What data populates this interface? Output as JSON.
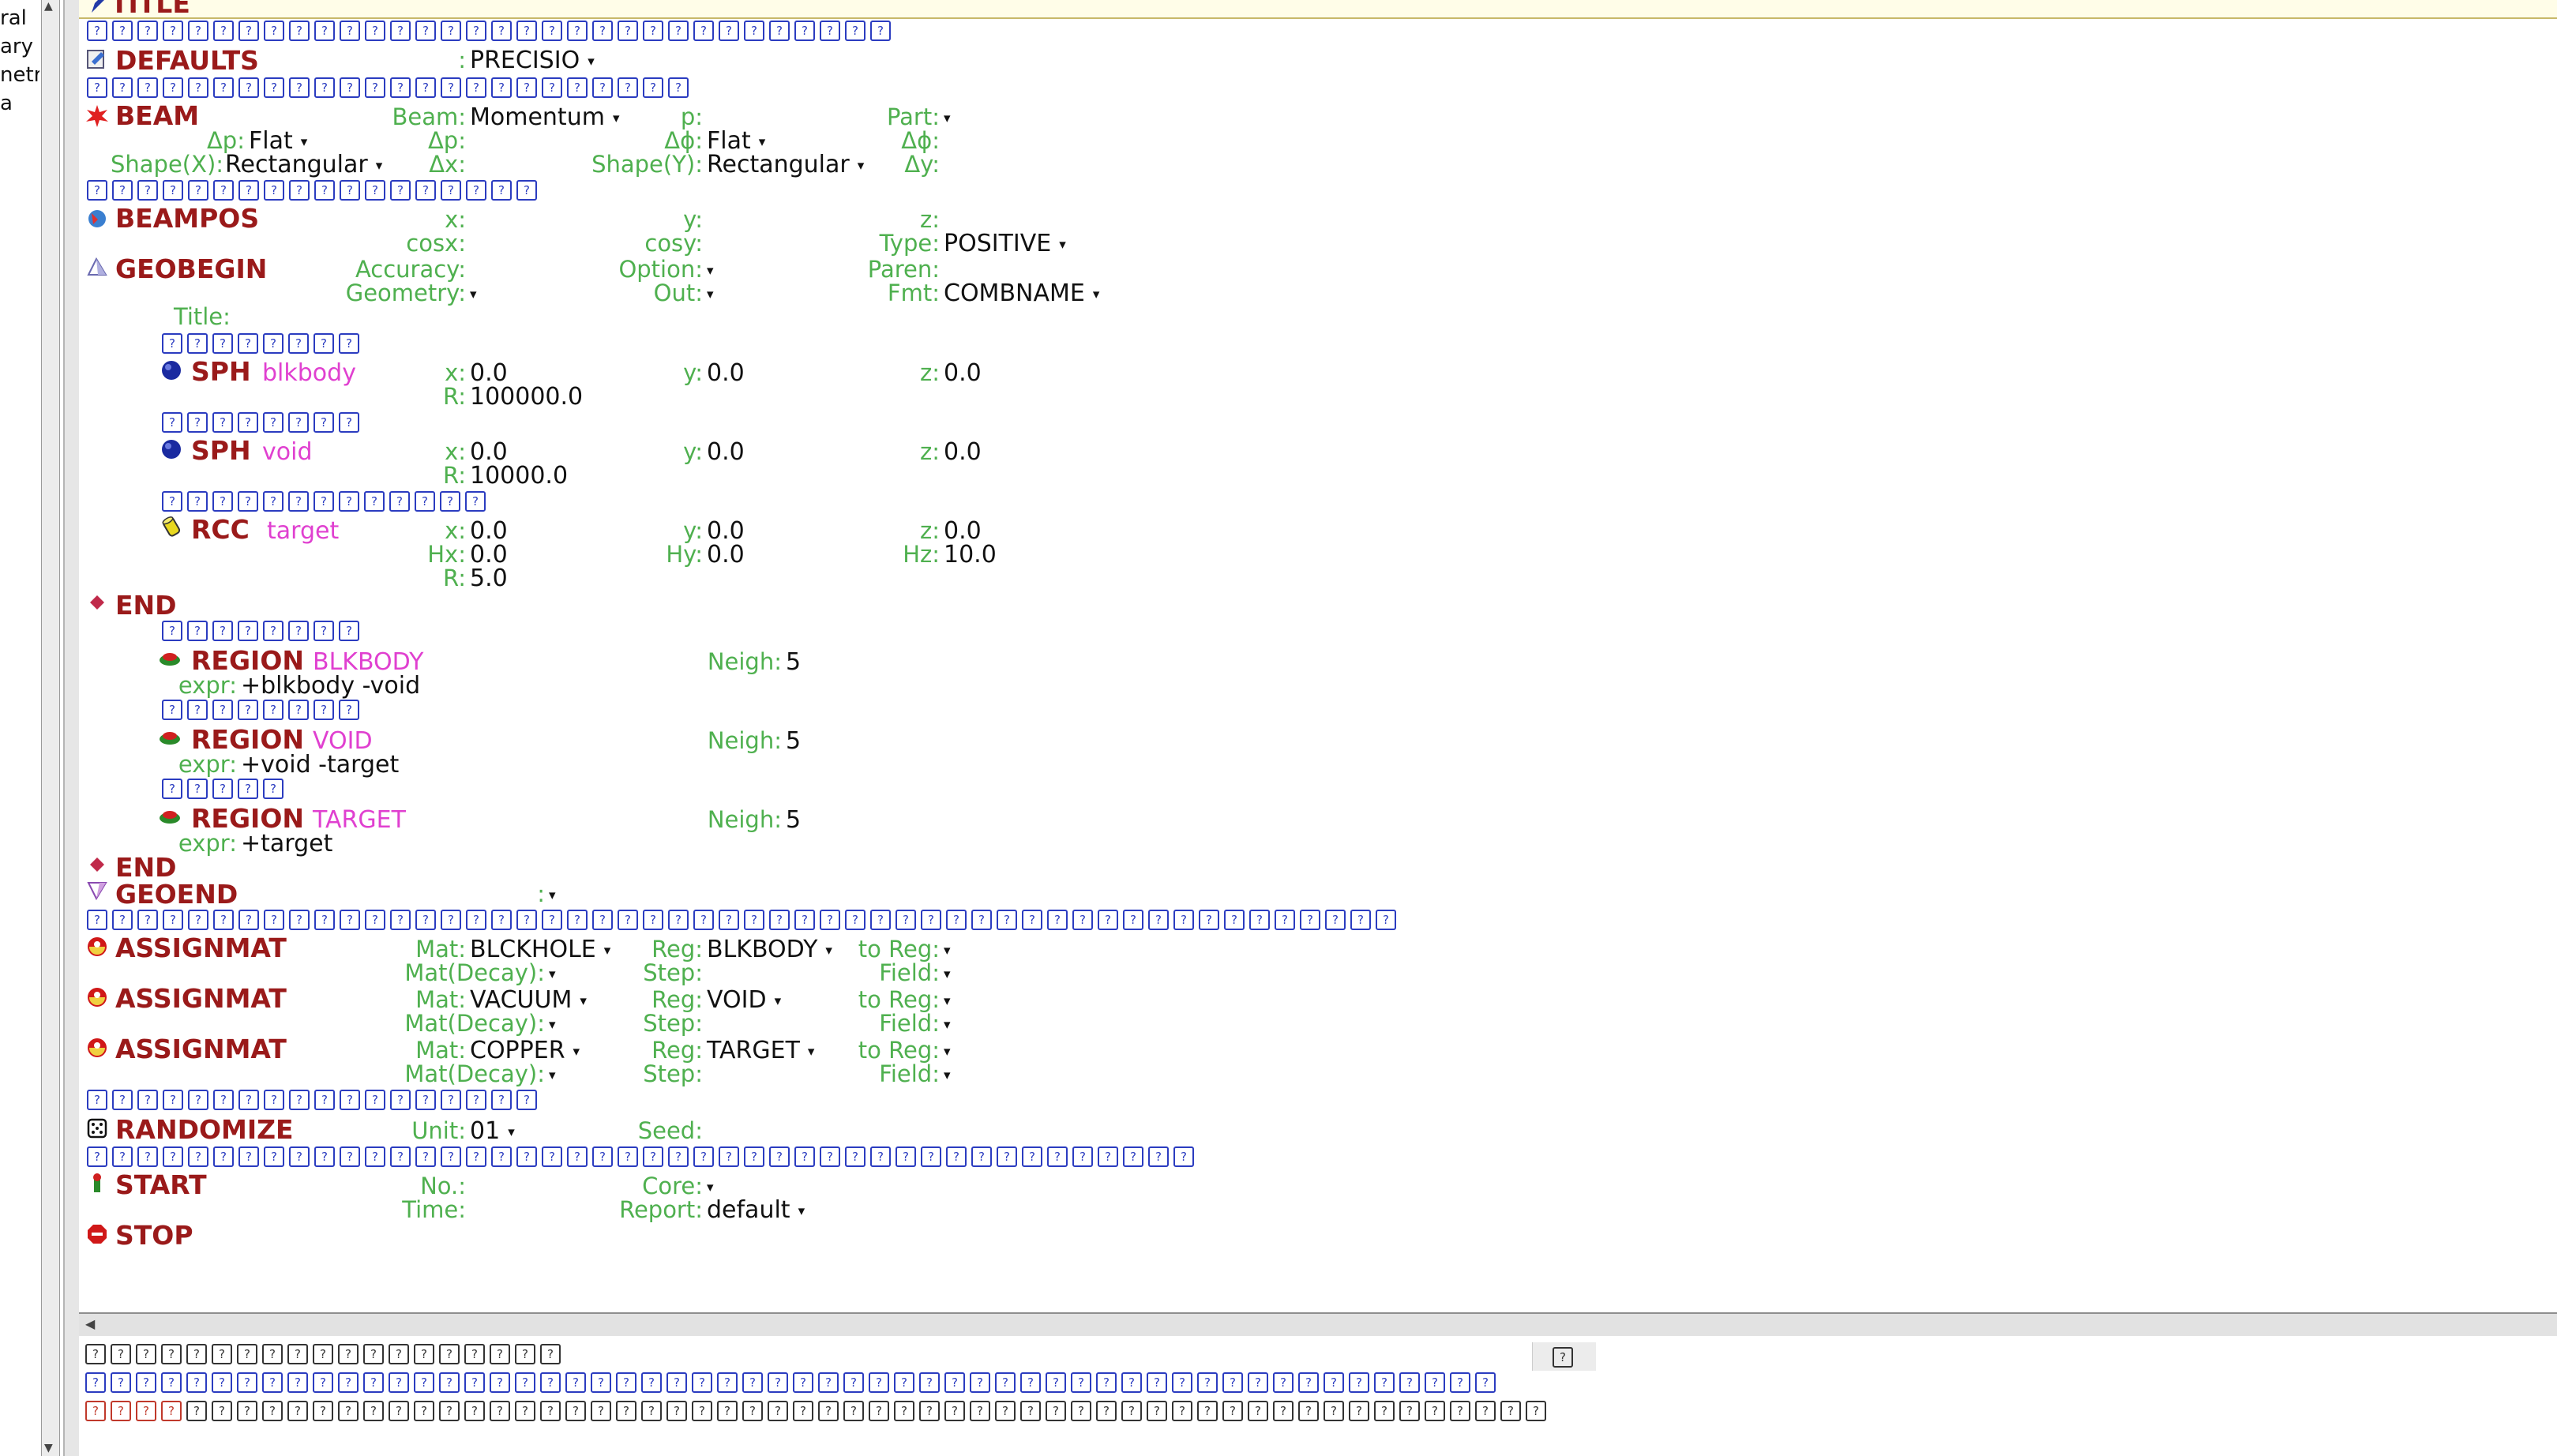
{
  "left_panel": {
    "lines": [
      "ral",
      "ary",
      "netr",
      "a"
    ]
  },
  "cards": {
    "title": {
      "tag": "TITLE"
    },
    "defaults": {
      "tag": "DEFAULTS",
      "value": "PRECISIO"
    },
    "beam": {
      "tag": "BEAM",
      "beam_label": "Beam:",
      "beam_value": "Momentum",
      "p_label": "p:",
      "part_label": "Part:",
      "dp_label": "Δp:",
      "dp_value": "Flat",
      "dp2_label": "Δp:",
      "dphi_label": "Δϕ:",
      "dphi_value": "Flat",
      "dphi2_label": "Δϕ:",
      "shapex_label": "Shape(X):",
      "shapex_value": "Rectangular",
      "dx_label": "Δx:",
      "shapey_label": "Shape(Y):",
      "shapey_value": "Rectangular",
      "dy_label": "Δy:"
    },
    "beampos": {
      "tag": "BEAMPOS",
      "x_label": "x:",
      "y_label": "y:",
      "z_label": "z:",
      "cosx_label": "cosx:",
      "cosy_label": "cosy:",
      "type_label": "Type:",
      "type_value": "POSITIVE"
    },
    "geobegin": {
      "tag": "GEOBEGIN",
      "accuracy_label": "Accuracy:",
      "option_label": "Option:",
      "paren_label": "Paren:",
      "geometry_label": "Geometry:",
      "out_label": "Out:",
      "fmt_label": "Fmt:",
      "fmt_value": "COMBNAME",
      "title_label": "Title:"
    },
    "sph_blkbody": {
      "tag": "SPH",
      "name": "blkbody",
      "x_label": "x:",
      "x": "0.0",
      "y_label": "y:",
      "y": "0.0",
      "z_label": "z:",
      "z": "0.0",
      "r_label": "R:",
      "r": "100000.0"
    },
    "sph_void": {
      "tag": "SPH",
      "name": "void",
      "x_label": "x:",
      "x": "0.0",
      "y_label": "y:",
      "y": "0.0",
      "z_label": "z:",
      "z": "0.0",
      "r_label": "R:",
      "r": "10000.0"
    },
    "rcc_target": {
      "tag": "RCC",
      "name": "target",
      "x_label": "x:",
      "x": "0.0",
      "y_label": "y:",
      "y": "0.0",
      "z_label": "z:",
      "z": "0.0",
      "hx_label": "Hx:",
      "hx": "0.0",
      "hy_label": "Hy:",
      "hy": "0.0",
      "hz_label": "Hz:",
      "hz": "10.0",
      "r_label": "R:",
      "r": "5.0"
    },
    "end1": {
      "tag": "END"
    },
    "region_blkbody": {
      "tag": "REGION",
      "name": "BLKBODY",
      "neigh_label": "Neigh:",
      "neigh": "5",
      "expr_label": "expr:",
      "expr": "+blkbody -void"
    },
    "region_void": {
      "tag": "REGION",
      "name": "VOID",
      "neigh_label": "Neigh:",
      "neigh": "5",
      "expr_label": "expr:",
      "expr": "+void -target"
    },
    "region_target": {
      "tag": "REGION",
      "name": "TARGET",
      "neigh_label": "Neigh:",
      "neigh": "5",
      "expr_label": "expr:",
      "expr": "+target"
    },
    "end2": {
      "tag": "END"
    },
    "geoend": {
      "tag": "GEOEND"
    },
    "assignmat1": {
      "tag": "ASSIGNMAT",
      "mat_label": "Mat:",
      "mat": "BLCKHOLE",
      "reg_label": "Reg:",
      "reg": "BLKBODY",
      "toreg_label": "to Reg:",
      "matdecay_label": "Mat(Decay):",
      "step_label": "Step:",
      "field_label": "Field:"
    },
    "assignmat2": {
      "tag": "ASSIGNMAT",
      "mat_label": "Mat:",
      "mat": "VACUUM",
      "reg_label": "Reg:",
      "reg": "VOID",
      "toreg_label": "to Reg:",
      "matdecay_label": "Mat(Decay):",
      "step_label": "Step:",
      "field_label": "Field:"
    },
    "assignmat3": {
      "tag": "ASSIGNMAT",
      "mat_label": "Mat:",
      "mat": "COPPER",
      "reg_label": "Reg:",
      "reg": "TARGET",
      "toreg_label": "to Reg:",
      "matdecay_label": "Mat(Decay):",
      "step_label": "Step:",
      "field_label": "Field:"
    },
    "randomize": {
      "tag": "RANDOMIZE",
      "unit_label": "Unit:",
      "unit": "01",
      "seed_label": "Seed:"
    },
    "start": {
      "tag": "START",
      "no_label": "No.:",
      "core_label": "Core:",
      "time_label": "Time:",
      "report_label": "Report:",
      "report_value": "default"
    },
    "stop": {
      "tag": "STOP"
    }
  },
  "comment_rows": {
    "after_title": 32,
    "after_defaults": 24,
    "after_beam": 18,
    "geobegin_title": 8,
    "before_sph_void": 8,
    "before_rcc": 13,
    "after_end": 8,
    "before_region_void": 8,
    "before_region_target": 5,
    "after_geoend": 52,
    "after_assignmat": 18,
    "after_randomize": 44
  },
  "bottom_pane": {
    "row1": 19,
    "row2": 56,
    "row3_red": 4,
    "row3": 54
  },
  "colors": {
    "tag": "#9a1a1a",
    "label": "#4fb04f",
    "name": "#e040d0",
    "comment_box": "#2b3cc0",
    "title_strip": "#fffde8"
  }
}
